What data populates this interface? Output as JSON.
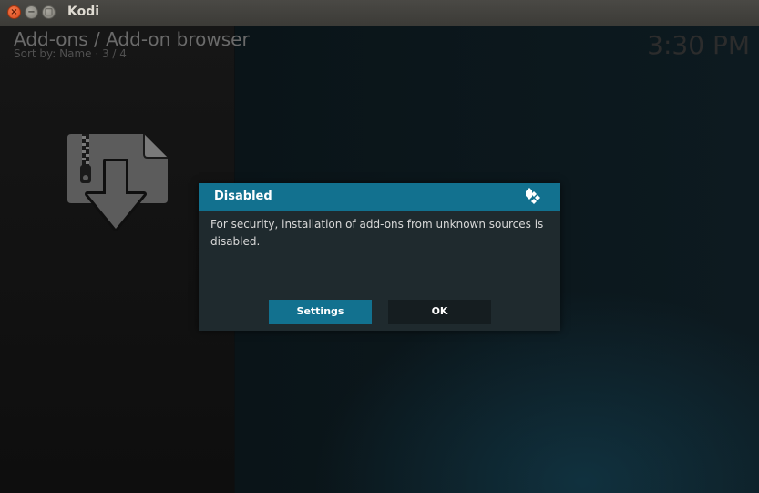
{
  "window": {
    "title": "Kodi",
    "close_glyph": "×",
    "minimize_glyph": "−",
    "maximize_glyph": "□"
  },
  "header": {
    "title": "Add-ons / Add-on browser",
    "subtitle": "Sort by: Name  ·  3 / 4",
    "clock": "3:30 PM"
  },
  "addon_icon": "zip-install-icon",
  "dialog": {
    "title": "Disabled",
    "message": "For security, installation of add-ons from unknown sources is disabled.",
    "buttons": {
      "settings": "Settings",
      "ok": "OK"
    }
  },
  "colors": {
    "accent": "#12718f",
    "dialog_bg": "#1f2a2e",
    "titlebar": "#3c3b37",
    "close_button": "#e05a2b"
  }
}
